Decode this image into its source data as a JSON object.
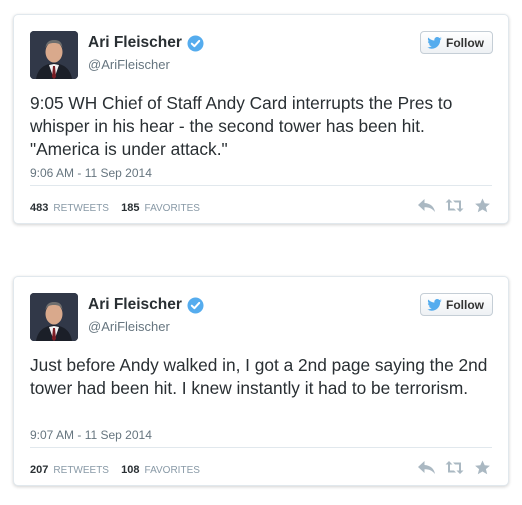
{
  "colors": {
    "card_border": "#e1e8ed",
    "verified_blue": "#55acee",
    "twitter_bird": "#55acee",
    "muted_text": "#66757f",
    "action_icons": "#aab8c2"
  },
  "tweets": [
    {
      "author": {
        "name": "Ari Fleischer",
        "handle": "@AriFleischer",
        "verified_icon": "verified-badge-icon"
      },
      "follow_label": "Follow",
      "text": "9:05  WH Chief of Staff Andy Card interrupts the Pres to whisper in his hear - the second tower has been hit. \"America is under attack.\"",
      "timestamp": "9:06 AM - 11 Sep 2014",
      "retweets": "483",
      "retweets_label": "RETWEETS",
      "favorites": "185",
      "favorites_label": "FAVORITES",
      "action_icons": [
        "reply-icon",
        "retweet-icon",
        "favorite-icon"
      ]
    },
    {
      "author": {
        "name": "Ari Fleischer",
        "handle": "@AriFleischer",
        "verified_icon": "verified-badge-icon"
      },
      "follow_label": "Follow",
      "text": "Just before Andy walked in, I got a 2nd page saying the 2nd tower had been hit.  I knew instantly it had to be terrorism.",
      "timestamp": "9:07 AM - 11 Sep 2014",
      "retweets": "207",
      "retweets_label": "RETWEETS",
      "favorites": "108",
      "favorites_label": "FAVORITES",
      "action_icons": [
        "reply-icon",
        "retweet-icon",
        "favorite-icon"
      ]
    }
  ]
}
